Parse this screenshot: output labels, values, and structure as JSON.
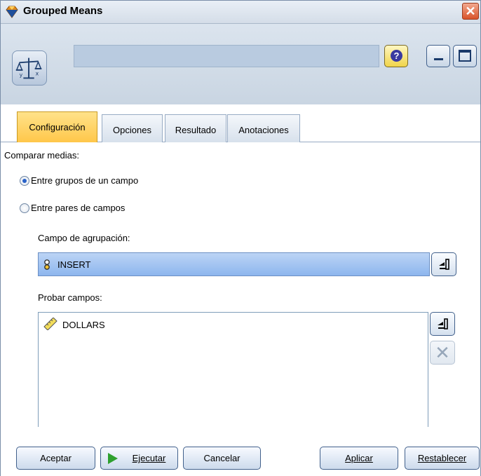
{
  "window": {
    "title": "Grouped Means",
    "close_glyph": "✕"
  },
  "header": {
    "node_name": "",
    "help_glyph": "?"
  },
  "tabs": [
    {
      "label": "Configuración"
    },
    {
      "label": "Opciones"
    },
    {
      "label": "Resultado"
    },
    {
      "label": "Anotaciones"
    }
  ],
  "settings": {
    "compare_label": "Comparar medias:",
    "radio_groups_label": "Entre grupos de un campo",
    "radio_pairs_label": "Entre pares de campos",
    "selected_radio": "groups",
    "grouping_field_label": "Campo de agrupación:",
    "grouping_field_value": "INSERT",
    "test_fields_label": "Probar campos:",
    "test_fields": [
      "DOLLARS"
    ]
  },
  "buttons": {
    "ok": "Aceptar",
    "run": "Ejecutar",
    "cancel": "Cancelar",
    "apply": "Aplicar",
    "reset": "Restablecer"
  },
  "colors": {
    "active_tab": "#ffc74a",
    "selected_field_bg": "#a6c6f2",
    "run_icon": "#2ea02e"
  },
  "icons": {
    "app": "diamond-logo-icon",
    "node": "balance-scale-icon",
    "help": "help-icon",
    "field_flag": "flag-icon",
    "field_measure": "ruler-icon",
    "picker": "field-picker-icon",
    "remove": "remove-x-icon",
    "run": "play-icon"
  }
}
